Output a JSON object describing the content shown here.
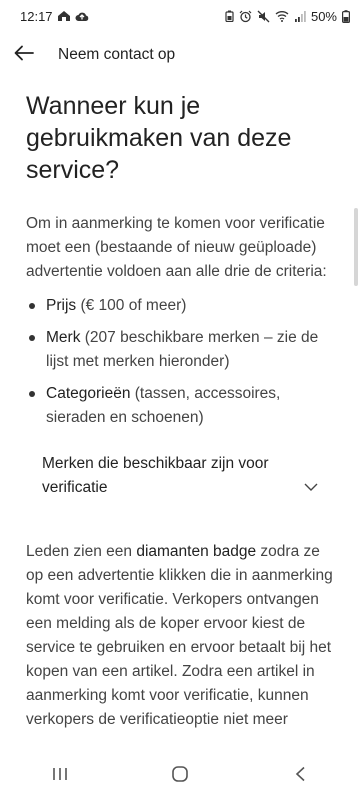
{
  "status_bar": {
    "time": "12:17",
    "battery": "50%"
  },
  "app_bar": {
    "title": "Neem contact op"
  },
  "content": {
    "heading": "Wanneer kun je gebruikmaken van deze service?",
    "intro": "Om in aanmerking te komen voor verificatie moet een (bestaande of nieuw geüploade) advertentie voldoen aan alle drie de criteria:",
    "criteria": [
      {
        "label": "Prijs",
        "detail": " (€ 100 of meer)"
      },
      {
        "label": "Merk",
        "detail": " (207 beschikbare merken – zie de lijst met merken hieronder)"
      },
      {
        "label": "Categorieën",
        "detail": " (tassen, accessoires, sieraden en schoenen)"
      }
    ],
    "accordion_label": "Merken die beschikbaar zijn voor verificatie",
    "body_part1": "Leden zien een ",
    "body_highlight": "diamanten badge",
    "body_part2": " zodra ze op een advertentie klikken die in aanmerking komt voor verificatie. Verkopers ontvangen een melding als de koper ervoor kiest de service te gebruiken en ervoor betaalt bij het kopen van een artikel. Zodra een artikel in aanmerking komt voor verificatie, kunnen verkopers de verificatieoptie niet meer"
  },
  "icons": {
    "back": "arrow-left-icon",
    "accordion": "chevron-down-icon",
    "nav_recents": "recents-icon",
    "nav_home": "home-icon",
    "nav_back": "back-icon"
  }
}
